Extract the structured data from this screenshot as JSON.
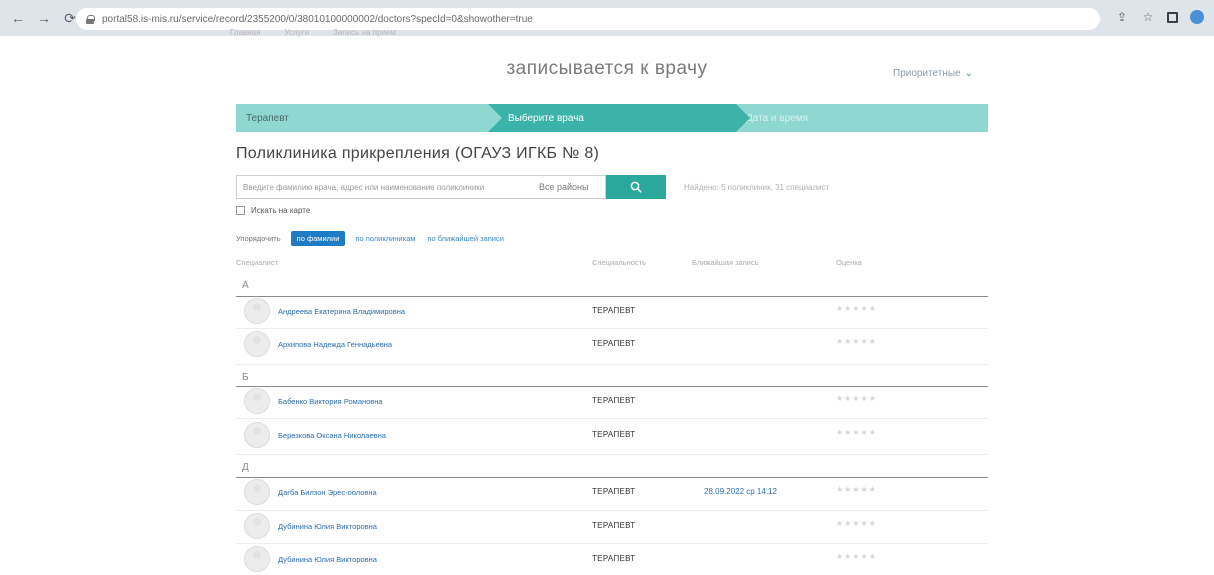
{
  "browser": {
    "url": "portal58.is-mis.ru/service/record/2355200/0/38010100000002/doctors?specId=0&showother=true",
    "ghost_tabs": [
      "Главная",
      "Услуги",
      "Запись на прием"
    ]
  },
  "header": {
    "title": "записывается к врачу",
    "language": "Приоритетные",
    "language_chevron": "⌄"
  },
  "steps": [
    {
      "label": "Терапевт"
    },
    {
      "label": "Выберите врача"
    },
    {
      "label": "Дата и время"
    }
  ],
  "clinic": {
    "title": "Поликлиника прикрепления (ОГАУЗ ИГКБ № 8)"
  },
  "search": {
    "placeholder": "Введите фамилию врача, адрес или наименование поликлиники",
    "district": "Все районы",
    "found": "Найдено: 5 поликлиник, 31 специалист"
  },
  "map_filter": {
    "label": "Искать на карте"
  },
  "sort": {
    "label": "Упорядочить",
    "options": [
      "по фамилии",
      "по поликлиникам",
      "по ближайшей записи"
    ]
  },
  "table": {
    "columns": [
      "Специалист",
      "Специальность",
      "Ближайшая запись",
      "Оценка"
    ]
  },
  "groups": [
    {
      "letter": "А",
      "doctors": [
        {
          "name": "Андреева Екатерина Владимировна",
          "specialty": "ТЕРАПЕВТ",
          "slot": "",
          "stars": "★★★★★"
        },
        {
          "name": "Архипова Надежда Геннадьевна",
          "specialty": "ТЕРАПЕВТ",
          "slot": "",
          "stars": "★★★★★"
        }
      ]
    },
    {
      "letter": "Б",
      "doctors": [
        {
          "name": "Бабенко Виктория Романовна",
          "specialty": "ТЕРАПЕВТ",
          "slot": "",
          "stars": "★★★★★"
        },
        {
          "name": "Березкова Оксана Николаевна",
          "specialty": "ТЕРАПЕВТ",
          "slot": "",
          "stars": "★★★★★"
        }
      ]
    },
    {
      "letter": "Д",
      "doctors": [
        {
          "name": "Дагба Билзон Эрес-ооловна",
          "specialty": "ТЕРАПЕВТ",
          "slot": "28.09.2022 ср 14:12",
          "stars": "★★★★★"
        },
        {
          "name": "Дубинина Юлия Викторовна",
          "specialty": "ТЕРАПЕВТ",
          "slot": "",
          "stars": "★★★★★"
        },
        {
          "name": "Дубинина Юлия Викторовна",
          "specialty": "ТЕРАПЕВТ",
          "slot": "",
          "stars": "★★★★★"
        }
      ]
    }
  ],
  "colors": {
    "accent": "#2ba79c",
    "step_light": "#8fd8d2",
    "step_active": "#3cb3a9",
    "link": "#2c6cb0",
    "sort_active": "#1f7bc4"
  }
}
